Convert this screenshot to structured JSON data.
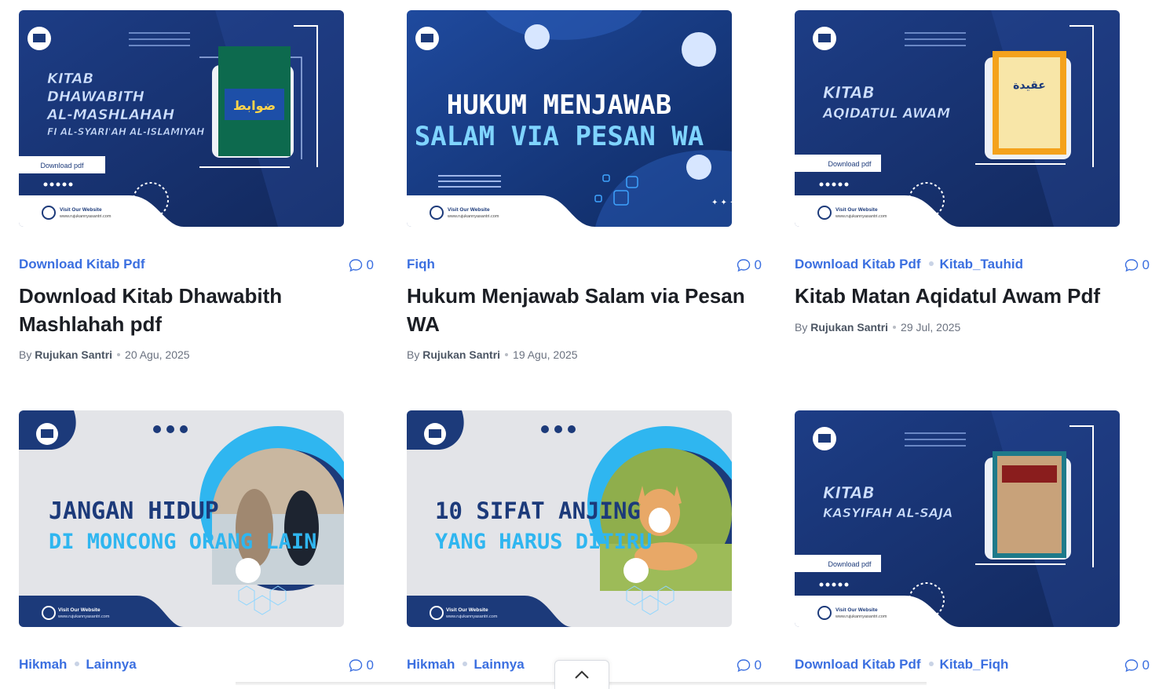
{
  "cards": [
    {
      "categories": [
        "Download Kitab Pdf"
      ],
      "comments": "0",
      "title": "Download Kitab Dhawabith Mashlahah pdf",
      "by": "By",
      "author": "Rujukan Santri",
      "date": "20 Agu, 2025",
      "thumb": {
        "l1": "KITAB",
        "l2": "DHAWABITH",
        "l3": "AL-MASHLAHAH",
        "l4": "FI AL-SYARI'AH AL-ISLAMIYAH",
        "btn": "Download pdf",
        "visit": "Visit Our Website",
        "url": "www.rujukannyasantri.com"
      }
    },
    {
      "categories": [
        "Fiqh"
      ],
      "comments": "0",
      "title": "Hukum Menjawab Salam via Pesan WA",
      "by": "By",
      "author": "Rujukan Santri",
      "date": "19 Agu, 2025",
      "thumb": {
        "l1": "HUKUM MENJAWAB",
        "l2": "SALAM VIA PESAN WA",
        "visit": "Visit Our Website",
        "url": "www.rujukannyasantri.com"
      }
    },
    {
      "categories": [
        "Download Kitab Pdf",
        "Kitab_Tauhid"
      ],
      "comments": "0",
      "title": "Kitab Matan Aqidatul Awam Pdf",
      "by": "By",
      "author": "Rujukan Santri",
      "date": "29 Jul, 2025",
      "thumb": {
        "l1": "KITAB",
        "l2": "AQIDATUL AWAM",
        "btn": "Download pdf",
        "visit": "Visit Our Website",
        "url": "www.rujukannyasantri.com"
      }
    },
    {
      "categories": [
        "Hikmah",
        "Lainnya"
      ],
      "comments": "0",
      "thumb": {
        "l1": "JANGAN HIDUP",
        "l2": "DI MONCONG ORANG LAIN",
        "visit": "Visit Our Website",
        "url": "www.rujukannyasantri.com"
      }
    },
    {
      "categories": [
        "Hikmah",
        "Lainnya"
      ],
      "comments": "0",
      "thumb": {
        "l1": "10 SIFAT ANJING",
        "l2": "YANG HARUS DITIRU",
        "visit": "Visit Our Website",
        "url": "www.rujukannyasantri.com"
      }
    },
    {
      "categories": [
        "Download Kitab Pdf",
        "Kitab_Fiqh"
      ],
      "comments": "0",
      "thumb": {
        "l1": "KITAB",
        "l2": "KASYIFAH AL-SAJA",
        "btn": "Download pdf",
        "visit": "Visit Our Website",
        "url": "www.rujukannyasantri.com"
      }
    }
  ],
  "colors": {
    "accent": "#3b6fe0",
    "title": "#1b1e24",
    "navy": "#1c3a7a",
    "navy_dark": "#0f2456",
    "cyan": "#2fb6f0"
  },
  "icons": {
    "comment": "comment-icon",
    "scroll_top": "chevron-up-icon",
    "globe": "globe-icon",
    "logo": "book-logo-icon"
  }
}
